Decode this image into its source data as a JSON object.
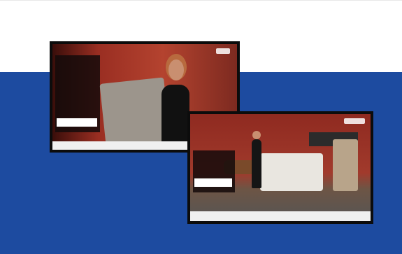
{
  "screens": [
    {
      "name": "broadcast-screenshot-1"
    },
    {
      "name": "broadcast-screenshot-2"
    }
  ],
  "colors": {
    "background_band": "#1d4ba0",
    "frame": "#0c0c0c",
    "accent_tag": "#c21d55"
  }
}
